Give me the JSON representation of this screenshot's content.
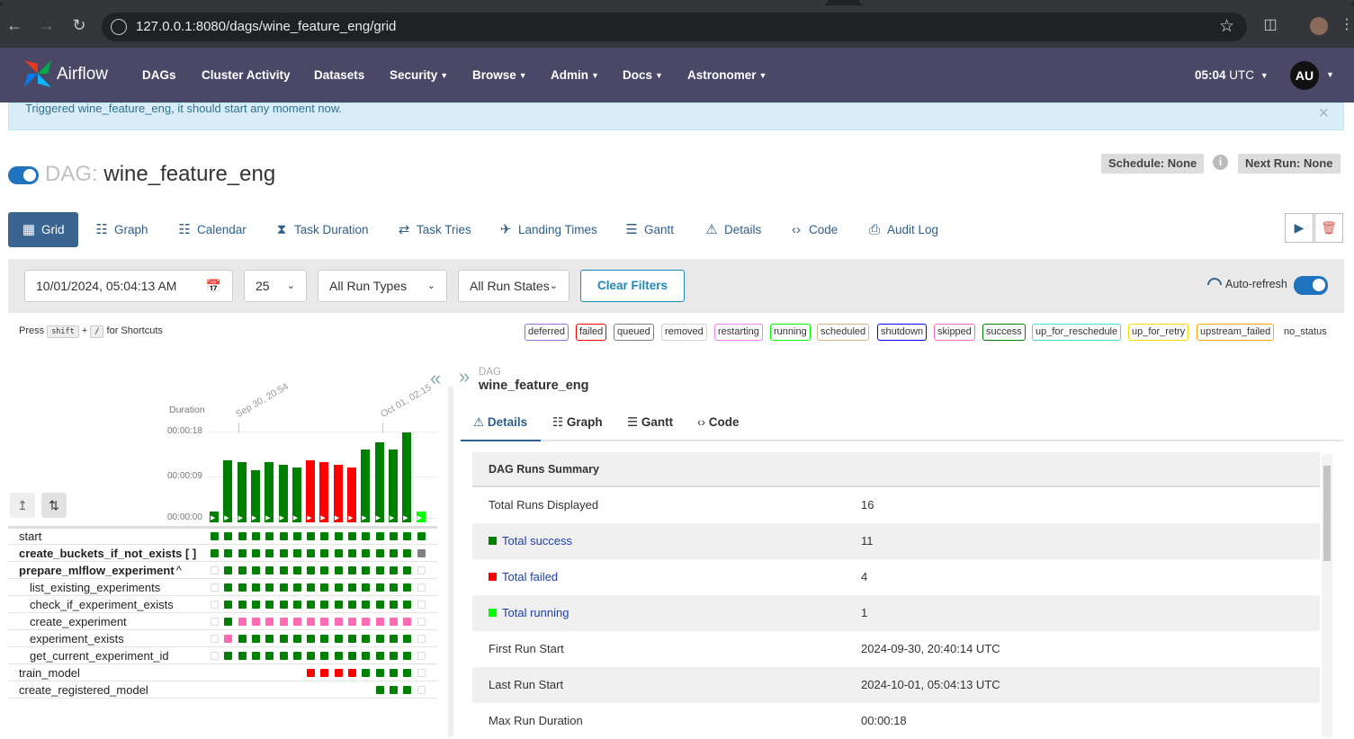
{
  "browser": {
    "url": "127.0.0.1:8080/dags/wine_feature_eng/grid"
  },
  "nav": {
    "brand": "Airflow",
    "menu": [
      {
        "label": "DAGs",
        "dropdown": false
      },
      {
        "label": "Cluster Activity",
        "dropdown": false
      },
      {
        "label": "Datasets",
        "dropdown": false
      },
      {
        "label": "Security",
        "dropdown": true
      },
      {
        "label": "Browse",
        "dropdown": true
      },
      {
        "label": "Admin",
        "dropdown": true
      },
      {
        "label": "Docs",
        "dropdown": true
      },
      {
        "label": "Astronomer",
        "dropdown": true
      }
    ],
    "time": "05:04",
    "tz": "UTC",
    "user_initials": "AU"
  },
  "alert": {
    "text": "Triggered wine_feature_eng, it should start any moment now.",
    "close": "×"
  },
  "dag": {
    "prefix": "DAG:",
    "name": "wine_feature_eng",
    "schedule": "Schedule: None",
    "next_run": "Next Run: None",
    "paused": false
  },
  "view_tabs": [
    {
      "label": "Grid",
      "icon": "grid-icon",
      "active": true
    },
    {
      "label": "Graph",
      "icon": "graph-icon"
    },
    {
      "label": "Calendar",
      "icon": "calendar-icon"
    },
    {
      "label": "Task Duration",
      "icon": "hourglass-icon"
    },
    {
      "label": "Task Tries",
      "icon": "retry-icon"
    },
    {
      "label": "Landing Times",
      "icon": "landing-icon"
    },
    {
      "label": "Gantt",
      "icon": "gantt-icon"
    },
    {
      "label": "Details",
      "icon": "warning-triangle-icon"
    },
    {
      "label": "Code",
      "icon": "code-icon"
    },
    {
      "label": "Audit Log",
      "icon": "audit-log-icon"
    }
  ],
  "filters": {
    "date": "10/01/2024, 05:04:13 AM",
    "num_runs": "25",
    "run_types": "All Run Types",
    "run_states": "All Run States",
    "clear_label": "Clear Filters",
    "auto_refresh_label": "Auto-refresh",
    "auto_refresh_on": true
  },
  "shortcuts": {
    "press": "Press",
    "key1": "shift",
    "plus": "+",
    "key2": "/",
    "suffix": "for Shortcuts"
  },
  "legend": [
    {
      "label": "deferred",
      "color": "#9370db"
    },
    {
      "label": "failed",
      "color": "#ff0000"
    },
    {
      "label": "queued",
      "color": "#808080"
    },
    {
      "label": "removed",
      "color": "#d3d3d3"
    },
    {
      "label": "restarting",
      "color": "#ee82ee"
    },
    {
      "label": "running",
      "color": "#00ff00"
    },
    {
      "label": "scheduled",
      "color": "#d2b48c"
    },
    {
      "label": "shutdown",
      "color": "#0000ff"
    },
    {
      "label": "skipped",
      "color": "#ff69b4"
    },
    {
      "label": "success",
      "color": "#008000"
    },
    {
      "label": "up_for_reschedule",
      "color": "#40e0d0"
    },
    {
      "label": "up_for_retry",
      "color": "#ffd700"
    },
    {
      "label": "upstream_failed",
      "color": "#ffa500"
    },
    {
      "label": "no_status",
      "color": null
    }
  ],
  "grid": {
    "duration_label": "Duration",
    "y_ticks": [
      "00:00:18",
      "00:00:09",
      "00:00:00"
    ],
    "date_labels": [
      "Sep 30, 20:54",
      "Oct 01, 02:15"
    ],
    "run_durations_sec": [
      1,
      12.5,
      12,
      10.5,
      12,
      11.5,
      11,
      12.5,
      12,
      11.5,
      11,
      14.5,
      16,
      14.5,
      18,
      1
    ],
    "run_states": [
      "success",
      "success",
      "success",
      "success",
      "success",
      "success",
      "success",
      "failed",
      "failed",
      "failed",
      "failed",
      "success",
      "success",
      "success",
      "success",
      "running"
    ],
    "tasks": [
      {
        "label": "start",
        "bold": false,
        "child": false,
        "cells": [
          "s",
          "s",
          "s",
          "s",
          "s",
          "s",
          "s",
          "s",
          "s",
          "s",
          "s",
          "s",
          "s",
          "s",
          "s",
          "s"
        ]
      },
      {
        "label": "create_buckets_if_not_exists [ ]",
        "bold": true,
        "child": false,
        "cells": [
          "s",
          "s",
          "s",
          "s",
          "s",
          "s",
          "s",
          "s",
          "s",
          "s",
          "s",
          "s",
          "s",
          "s",
          "s",
          "q"
        ]
      },
      {
        "label": "prepare_mlflow_experiment",
        "caret": "^",
        "bold": true,
        "child": false,
        "cells": [
          "n",
          "s",
          "s",
          "s",
          "s",
          "s",
          "s",
          "s",
          "s",
          "s",
          "s",
          "s",
          "s",
          "s",
          "s",
          "n"
        ]
      },
      {
        "label": "list_existing_experiments",
        "bold": false,
        "child": true,
        "cells": [
          "n",
          "s",
          "s",
          "s",
          "s",
          "s",
          "s",
          "s",
          "s",
          "s",
          "s",
          "s",
          "s",
          "s",
          "s",
          "n"
        ]
      },
      {
        "label": "check_if_experiment_exists",
        "bold": false,
        "child": true,
        "cells": [
          "n",
          "s",
          "s",
          "s",
          "s",
          "s",
          "s",
          "s",
          "s",
          "s",
          "s",
          "s",
          "s",
          "s",
          "s",
          "n"
        ]
      },
      {
        "label": "create_experiment",
        "bold": false,
        "child": true,
        "cells": [
          "n",
          "s",
          "k",
          "k",
          "k",
          "k",
          "k",
          "k",
          "k",
          "k",
          "k",
          "k",
          "k",
          "k",
          "k",
          "n"
        ]
      },
      {
        "label": "experiment_exists",
        "bold": false,
        "child": true,
        "cells": [
          "n",
          "k",
          "s",
          "s",
          "s",
          "s",
          "s",
          "s",
          "s",
          "s",
          "s",
          "s",
          "s",
          "s",
          "s",
          "n"
        ]
      },
      {
        "label": "get_current_experiment_id",
        "bold": false,
        "child": true,
        "cells": [
          "n",
          "s",
          "s",
          "s",
          "s",
          "s",
          "s",
          "s",
          "s",
          "s",
          "s",
          "s",
          "s",
          "s",
          "s",
          "n"
        ]
      },
      {
        "label": "train_model",
        "bold": false,
        "child": false,
        "cells": [
          "-",
          "-",
          "-",
          "-",
          "-",
          "-",
          "-",
          "f",
          "f",
          "f",
          "f",
          "s",
          "s",
          "s",
          "s",
          "n"
        ]
      },
      {
        "label": "create_registered_model",
        "bold": false,
        "child": false,
        "cells": [
          "-",
          "-",
          "-",
          "-",
          "-",
          "-",
          "-",
          "-",
          "-",
          "-",
          "-",
          "-",
          "s",
          "s",
          "s",
          "n"
        ]
      }
    ]
  },
  "details": {
    "dag_caption": "DAG",
    "dag_name": "wine_feature_eng",
    "tabs": [
      {
        "label": "Details",
        "icon": "warning-triangle-icon",
        "active": true
      },
      {
        "label": "Graph",
        "icon": "graph-icon"
      },
      {
        "label": "Gantt",
        "icon": "gantt-icon"
      },
      {
        "label": "Code",
        "icon": "code-icon"
      }
    ],
    "summary_title": "DAG Runs Summary",
    "rows": [
      {
        "key": "Total Runs Displayed",
        "value": "16"
      },
      {
        "key": "Total success",
        "value": "11",
        "color": "#008000",
        "link": true
      },
      {
        "key": "Total failed",
        "value": "4",
        "color": "#ff0000",
        "link": true
      },
      {
        "key": "Total running",
        "value": "1",
        "color": "#00ff00",
        "link": true
      },
      {
        "key": "First Run Start",
        "value": "2024-09-30, 20:40:14 UTC"
      },
      {
        "key": "Last Run Start",
        "value": "2024-10-01, 05:04:13 UTC"
      },
      {
        "key": "Max Run Duration",
        "value": "00:00:18"
      }
    ]
  }
}
